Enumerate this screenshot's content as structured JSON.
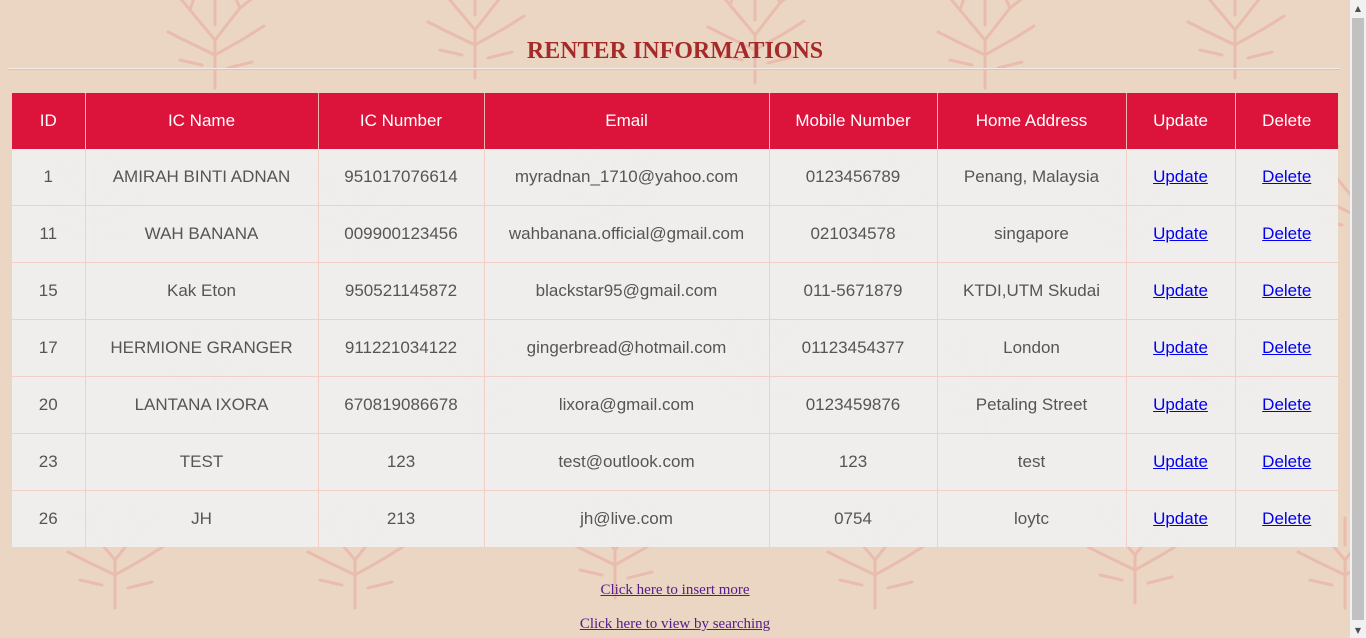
{
  "page": {
    "title": "RENTER INFORMATIONS"
  },
  "table": {
    "headers": [
      "ID",
      "IC Name",
      "IC Number",
      "Email",
      "Mobile Number",
      "Home Address",
      "Update",
      "Delete"
    ],
    "rows": [
      {
        "id": "1",
        "ic_name": "AMIRAH BINTI ADNAN",
        "ic_number": "951017076614",
        "email": "myradnan_1710@yahoo.com",
        "mobile": "0123456789",
        "address": "Penang, Malaysia",
        "update": "Update",
        "delete": "Delete"
      },
      {
        "id": "11",
        "ic_name": "WAH BANANA",
        "ic_number": "009900123456",
        "email": "wahbanana.official@gmail.com",
        "mobile": "021034578",
        "address": "singapore",
        "update": "Update",
        "delete": "Delete"
      },
      {
        "id": "15",
        "ic_name": "Kak Eton",
        "ic_number": "950521145872",
        "email": "blackstar95@gmail.com",
        "mobile": "011-5671879",
        "address": "KTDI,UTM Skudai",
        "update": "Update",
        "delete": "Delete"
      },
      {
        "id": "17",
        "ic_name": "HERMIONE GRANGER",
        "ic_number": "911221034122",
        "email": "gingerbread@hotmail.com",
        "mobile": "01123454377",
        "address": "London",
        "update": "Update",
        "delete": "Delete"
      },
      {
        "id": "20",
        "ic_name": "LANTANA IXORA",
        "ic_number": "670819086678",
        "email": "lixora@gmail.com",
        "mobile": "0123459876",
        "address": "Petaling Street",
        "update": "Update",
        "delete": "Delete"
      },
      {
        "id": "23",
        "ic_name": "TEST",
        "ic_number": "123",
        "email": "test@outlook.com",
        "mobile": "123",
        "address": "test",
        "update": "Update",
        "delete": "Delete"
      },
      {
        "id": "26",
        "ic_name": "JH",
        "ic_number": "213",
        "email": "jh@live.com",
        "mobile": "0754",
        "address": "loytc",
        "update": "Update",
        "delete": "Delete"
      }
    ]
  },
  "footer": {
    "insert_link": "Click here to insert more",
    "search_link": "Click here to view by searching"
  },
  "colors": {
    "background": "#ead6c2",
    "header_bg": "#dc143c",
    "title": "#a52a2a",
    "link": "#0000ee",
    "visited_link": "#551a8b"
  }
}
